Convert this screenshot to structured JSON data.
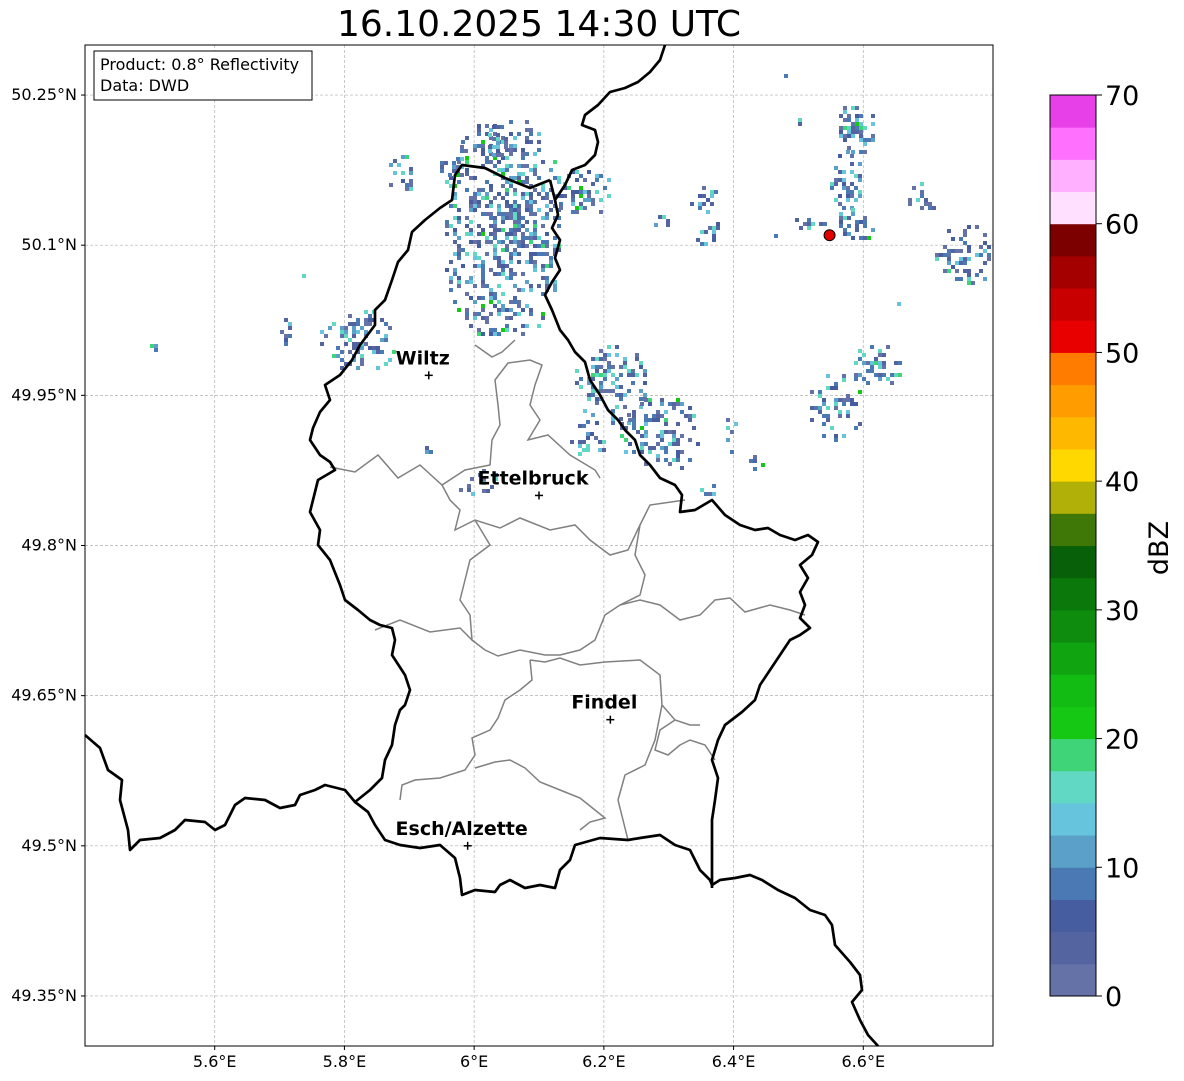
{
  "title": "16.10.2025 14:30 UTC",
  "infobox": {
    "line1": "Product: 0.8° Reflectivity",
    "line2": "Data: DWD"
  },
  "axes": {
    "lat_ticks": [
      {
        "value": 50.25,
        "label": "50.25°N"
      },
      {
        "value": 50.1,
        "label": "50.1°N"
      },
      {
        "value": 49.95,
        "label": "49.95°N"
      },
      {
        "value": 49.8,
        "label": "49.8°N"
      },
      {
        "value": 49.65,
        "label": "49.65°N"
      },
      {
        "value": 49.5,
        "label": "49.5°N"
      },
      {
        "value": 49.35,
        "label": "49.35°N"
      }
    ],
    "lon_ticks": [
      {
        "value": 5.6,
        "label": "5.6°E"
      },
      {
        "value": 5.8,
        "label": "5.8°E"
      },
      {
        "value": 6.0,
        "label": "6°E"
      },
      {
        "value": 6.2,
        "label": "6.2°E"
      },
      {
        "value": 6.4,
        "label": "6.4°E"
      },
      {
        "value": 6.6,
        "label": "6.6°E"
      }
    ],
    "lon_range": [
      5.4,
      6.8
    ],
    "lat_range": [
      49.3,
      50.3
    ],
    "grid": true
  },
  "cities": [
    {
      "name": "Wiltz",
      "lon": 5.93,
      "lat": 49.97
    },
    {
      "name": "Ettelbruck",
      "lon": 6.1,
      "lat": 49.85
    },
    {
      "name": "Findel",
      "lon": 6.21,
      "lat": 49.626
    },
    {
      "name": "Esch/Alzette",
      "lon": 5.99,
      "lat": 49.5
    }
  ],
  "radar_site": {
    "lon": 6.548,
    "lat": 50.11,
    "color": "#e00000"
  },
  "colorbar": {
    "label": "dBZ",
    "min": 0,
    "max": 70,
    "tick_values": [
      0,
      10,
      20,
      30,
      40,
      50,
      60,
      70
    ],
    "tick_labels": [
      "0",
      "10",
      "20",
      "30",
      "40",
      "50",
      "60",
      "70"
    ],
    "colors": [
      "#6472a8",
      "#5364a0",
      "#465ea0",
      "#4a79b4",
      "#5aa0c8",
      "#66c4dc",
      "#60d8c4",
      "#40d478",
      "#14c814",
      "#12bc12",
      "#10a410",
      "#0e8c0e",
      "#0a780a",
      "#086008",
      "#407808",
      "#b0b008",
      "#ffd800",
      "#ffb800",
      "#ff9c00",
      "#ff7c00",
      "#e80000",
      "#c80000",
      "#a40000",
      "#7c0000",
      "#ffe0ff",
      "#ffb0ff",
      "#ff70ff",
      "#e840e8"
    ]
  }
}
